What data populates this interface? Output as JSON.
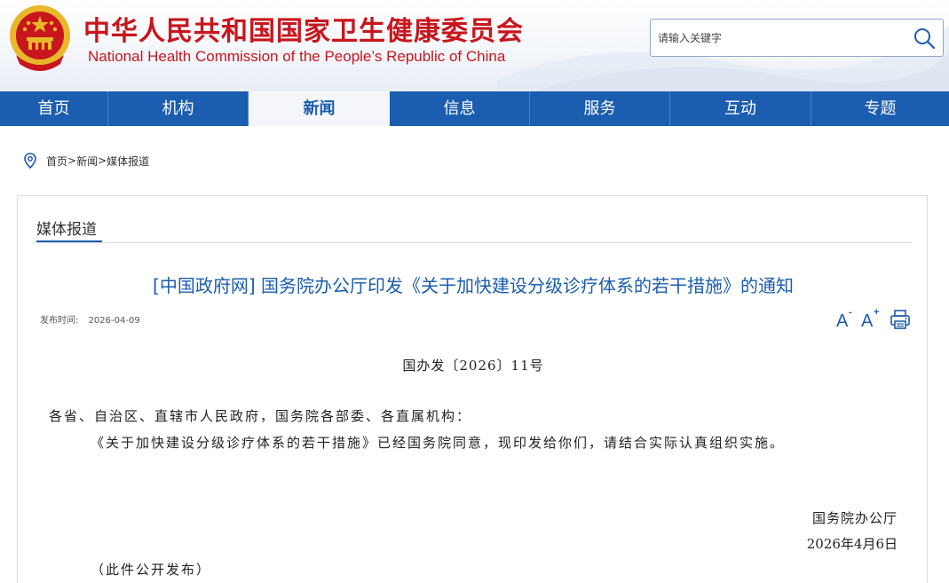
{
  "header": {
    "title_cn": "中华人民共和国国家卫生健康委员会",
    "title_en": "National Health Commission of the People’s  Republic of China",
    "search_placeholder": "请输入关键字"
  },
  "nav": {
    "items": [
      {
        "label": "首页"
      },
      {
        "label": "机构"
      },
      {
        "label": "新闻"
      },
      {
        "label": "信息"
      },
      {
        "label": "服务"
      },
      {
        "label": "互动"
      },
      {
        "label": "专题"
      }
    ],
    "active": "新闻"
  },
  "breadcrumb": {
    "items": [
      "首页",
      "新闻",
      "媒体报道"
    ],
    "separator": ">"
  },
  "section": {
    "tab_label": "媒体报道"
  },
  "article": {
    "title": "[中国政府网] 国务院办公厅印发《关于加快建设分级诊疗体系的若干措施》的通知",
    "publish_label": "发布时间:",
    "publish_date": "2026-04-09",
    "font_decrease": "A",
    "font_decrease_sup": "-",
    "font_increase": "A",
    "font_increase_sup": "+",
    "doc_number": "国办发〔2026〕11号",
    "addressee": "各省、自治区、直辖市人民政府，国务院各部委、各直属机构：",
    "paragraph": "《关于加快建设分级诊疗体系的若干措施》已经国务院同意，现印发给你们，请结合实际认真组织实施。",
    "sign_org": "国务院办公厅",
    "sign_date": "2026年4月6日",
    "public_note": "（此件公开发布）"
  },
  "colors": {
    "brand_red": "#c8161d",
    "nav_blue": "#1b5dae",
    "emblem_gold": "#e8b82a"
  },
  "icons": {
    "search": "search-icon",
    "location": "location-pin-icon",
    "print": "printer-icon",
    "emblem": "national-emblem-icon"
  }
}
